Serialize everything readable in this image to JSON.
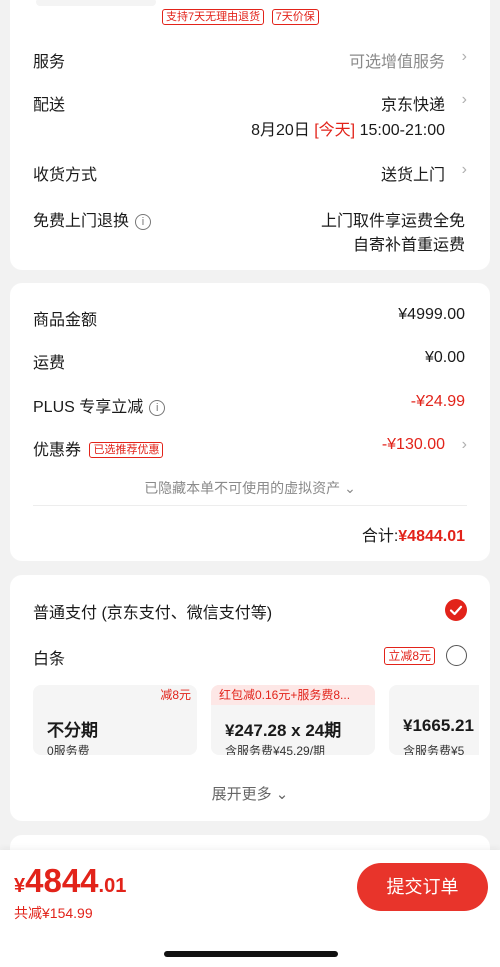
{
  "top_card": {
    "guarantees": [
      "支持7天无理由退货",
      "7天价保"
    ],
    "service": {
      "label": "服务",
      "value": "可选增值服务"
    },
    "delivery": {
      "label": "配送",
      "carrier": "京东快递",
      "date": "8月20日",
      "day_tag": "[今天]",
      "time": "15:00-21:00"
    },
    "receive_method": {
      "label": "收货方式",
      "value": "送货上门"
    },
    "free_return": {
      "label": "免费上门退换",
      "line1": "上门取件享运费全免",
      "line2": "自寄补首重运费"
    }
  },
  "price_card": {
    "goods_amount": {
      "label": "商品金额",
      "value": "¥4999.00"
    },
    "shipping": {
      "label": "运费",
      "value": "¥0.00"
    },
    "plus": {
      "label": "PLUS 专享立减",
      "value": "-¥24.99"
    },
    "coupon": {
      "label": "优惠券",
      "tag": "已选推荐优惠",
      "value": "-¥130.00"
    },
    "hidden_assets": "已隐藏本单不可使用的虚拟资产",
    "total": {
      "label": "合计:",
      "value": "¥4844.01"
    }
  },
  "payment_card": {
    "normal_pay": "普通支付 (京东支付、微信支付等)",
    "baitiao": {
      "label": "白条",
      "tag": "立减8元"
    },
    "installments": [
      {
        "header": "减8元",
        "title": "不分期",
        "fee": "0服务费"
      },
      {
        "header": "红包减0.16元+服务费8...",
        "title": "¥247.28 x 24期",
        "fee": "含服务费¥45.29/期"
      },
      {
        "header": "",
        "title": "¥1665.21",
        "fee": "含服务费¥5"
      }
    ],
    "expand": "展开更多"
  },
  "footer": {
    "currency": "¥",
    "price_int": "4844",
    "price_dec": ".01",
    "saved": "共减¥154.99",
    "submit": "提交订单"
  },
  "colors": {
    "accent": "#e2231a",
    "background": "#f2f2f2"
  }
}
